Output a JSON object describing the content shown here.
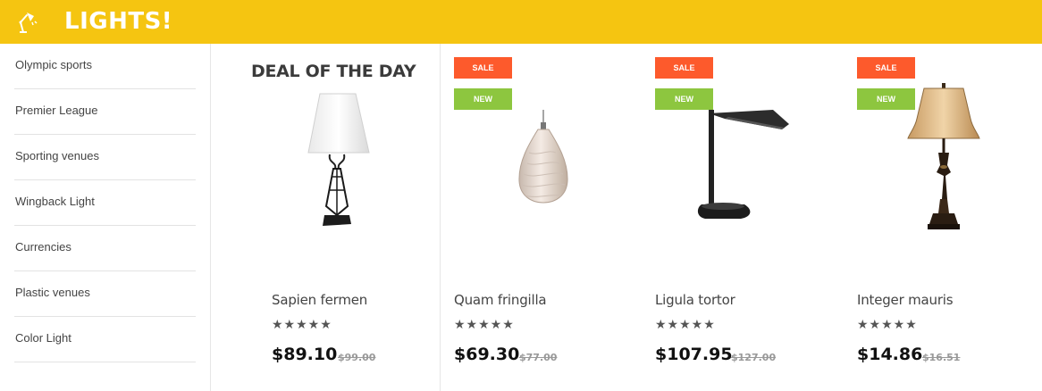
{
  "header": {
    "title": "LIGHTS!",
    "logo_icon": "desk-lamp-icon"
  },
  "sidebar": {
    "items": [
      {
        "label": "Olympic sports"
      },
      {
        "label": "Premier League"
      },
      {
        "label": "Sporting venues"
      },
      {
        "label": "Wingback Light"
      },
      {
        "label": "Currencies"
      },
      {
        "label": "Plastic venues"
      },
      {
        "label": "Color Light"
      }
    ]
  },
  "deal": {
    "title": "DEAL OF THE DAY",
    "name": "Sapien fermen",
    "rating": 5,
    "stars": "★★★★★",
    "price": "$89.10",
    "old_price": "$99.00"
  },
  "products": [
    {
      "name": "Quam fringilla",
      "badges": [
        "SALE",
        "NEW"
      ],
      "rating": 5,
      "stars": "★★★★★",
      "price": "$69.30",
      "old_price": "$77.00"
    },
    {
      "name": "Ligula tortor",
      "badges": [
        "SALE",
        "NEW"
      ],
      "rating": 5,
      "stars": "★★★★★",
      "price": "$107.95",
      "old_price": "$127.00"
    },
    {
      "name": "Integer mauris",
      "badges": [
        "SALE",
        "NEW"
      ],
      "rating": 5,
      "stars": "★★★★★",
      "price": "$14.86",
      "old_price": "$16.51"
    }
  ],
  "colors": {
    "brand": "#f5c511",
    "sale": "#fd5a2c",
    "new": "#8dc63f"
  }
}
